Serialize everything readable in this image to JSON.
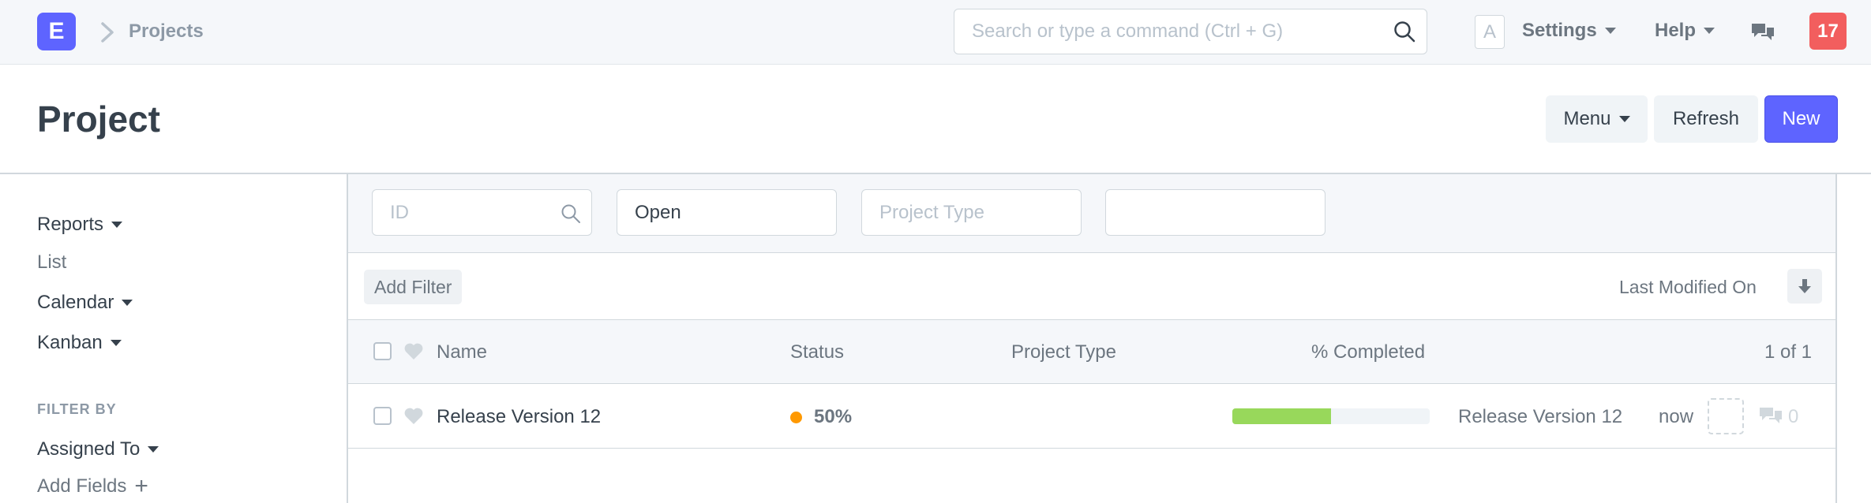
{
  "colors": {
    "primary": "#5e64ff",
    "badge": "#f25e5e",
    "status_orange": "#ff9900",
    "progress_green": "#98d85b"
  },
  "navbar": {
    "logo_letter": "E",
    "breadcrumb": "Projects",
    "search_placeholder": "Search or type a command (Ctrl + G)",
    "avatar_letter": "A",
    "settings_label": "Settings",
    "help_label": "Help",
    "notification_count": "17",
    "icons": [
      "chevron-right-icon",
      "search-icon",
      "chat-icon"
    ]
  },
  "page": {
    "title": "Project",
    "menu_label": "Menu",
    "refresh_label": "Refresh",
    "new_label": "New"
  },
  "sidebar": {
    "reports_label": "Reports",
    "list_label": "List",
    "calendar_label": "Calendar",
    "kanban_label": "Kanban",
    "filter_by_label": "FILTER BY",
    "assigned_to_label": "Assigned To",
    "add_fields_label": "Add Fields"
  },
  "filters": {
    "id_placeholder": "ID",
    "status_value": "Open",
    "project_type_placeholder": "Project Type",
    "extra_value": ""
  },
  "toolbar": {
    "add_filter_label": "Add Filter",
    "sort_label": "Last Modified On"
  },
  "list": {
    "columns": {
      "name": "Name",
      "status": "Status",
      "project_type": "Project Type",
      "percent_completed": "% Completed"
    },
    "count_text": "1 of 1",
    "rows": [
      {
        "name": "Release Version 12",
        "status": "50%",
        "project_type": "",
        "percent_completed": 0.5,
        "ref_name": "Release Version 12",
        "modified": "now",
        "comment_count": "0"
      }
    ]
  }
}
